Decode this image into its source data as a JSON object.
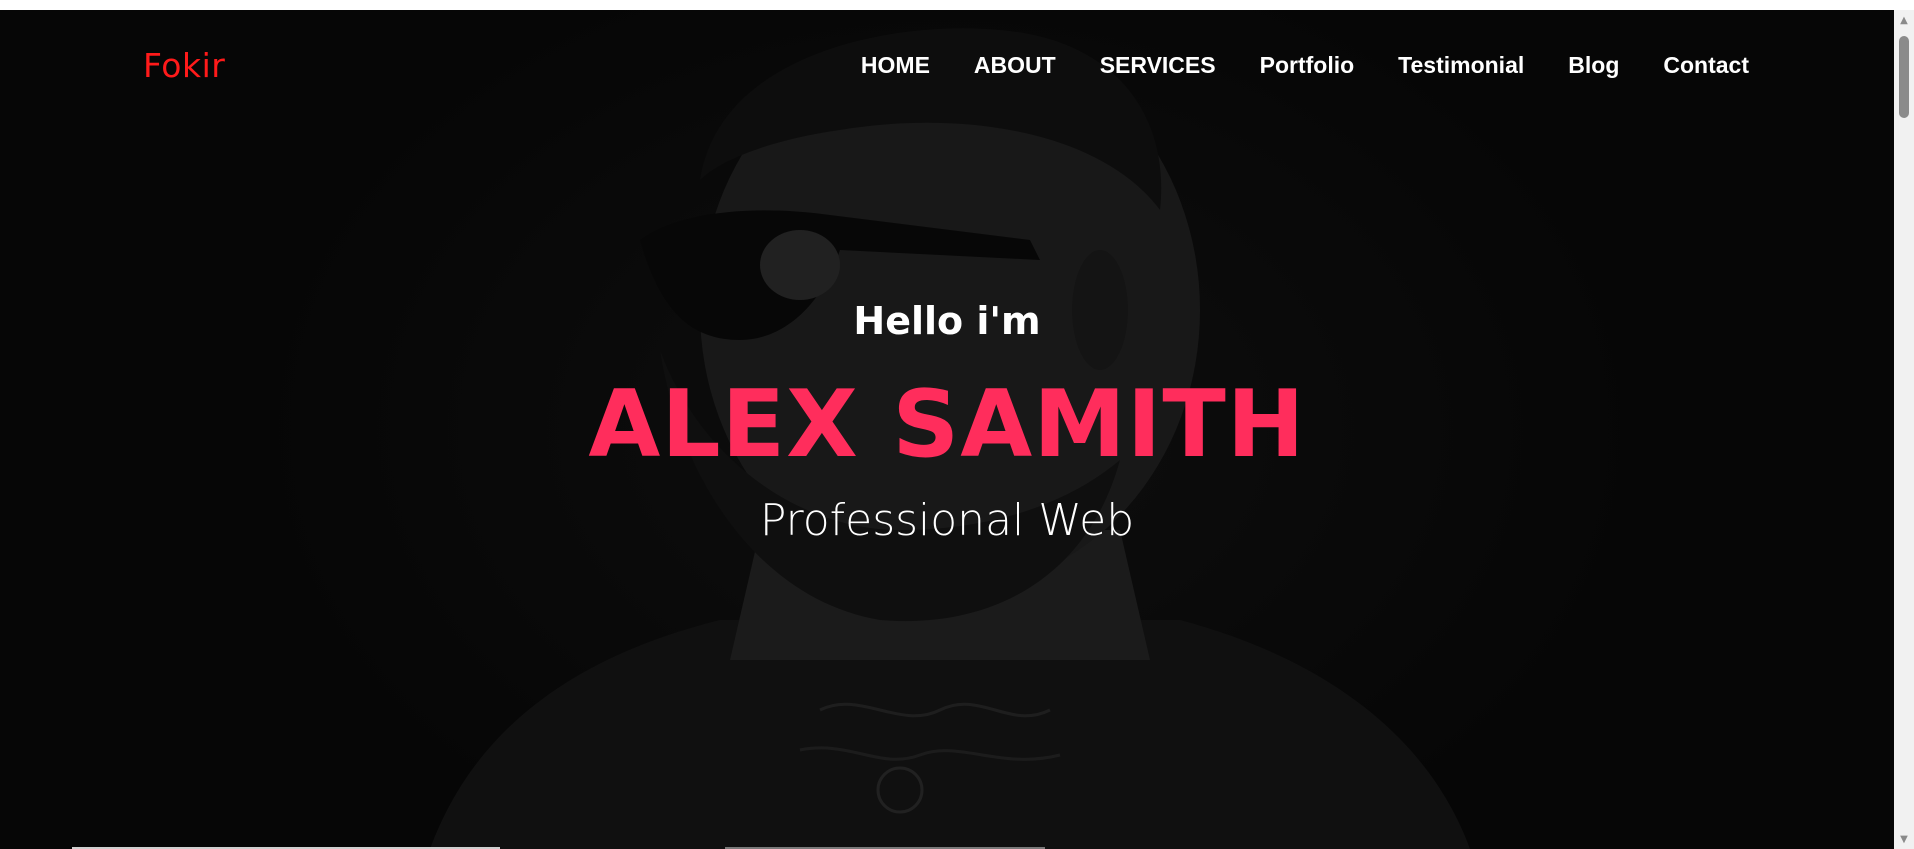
{
  "navbar": {
    "logo": "Fokir",
    "items": [
      {
        "label": "HOME"
      },
      {
        "label": "ABOUT"
      },
      {
        "label": "SERVICES"
      },
      {
        "label": "Portfolio"
      },
      {
        "label": "Testimonial"
      },
      {
        "label": "Blog"
      },
      {
        "label": "Contact"
      }
    ]
  },
  "hero": {
    "greeting": "Hello i'm",
    "name": "ALEX SAMITH",
    "role": "Professional Web"
  },
  "colors": {
    "logo": "#ff1a1a",
    "name_accent": "#ff2d5c",
    "background": "#0c0c0c"
  },
  "icons": {
    "scroll_up": "triangle-up-icon",
    "scroll_down": "triangle-down-icon"
  }
}
